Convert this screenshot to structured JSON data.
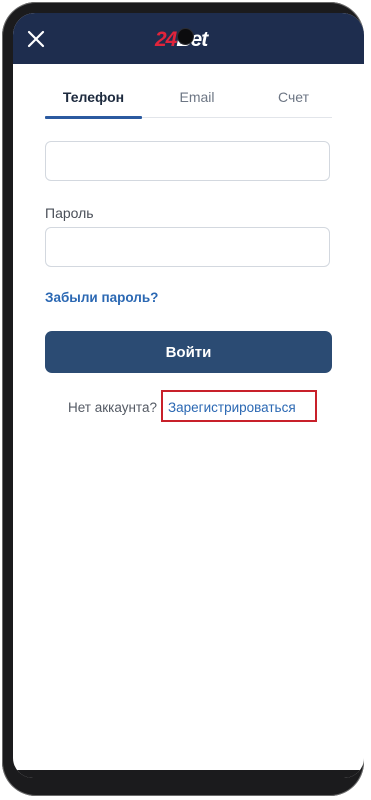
{
  "header": {
    "logo_number": "24",
    "logo_text": "Bet",
    "close_icon": "close-icon"
  },
  "tabs": [
    {
      "label": "Телефон",
      "active": true
    },
    {
      "label": "Email",
      "active": false
    },
    {
      "label": "Счет",
      "active": false
    }
  ],
  "form": {
    "phone_value": "",
    "password_label": "Пароль",
    "password_value": "",
    "forgot_link": "Забыли пароль?",
    "login_button": "Войти"
  },
  "footer": {
    "no_account_text": "Нет аккаунта?",
    "register_link": "Зарегистрироваться"
  },
  "colors": {
    "header_bg": "#1e2d4e",
    "accent_link": "#2b68b3",
    "button_bg": "#2b4b73",
    "logo_red": "#e0243b",
    "highlight_box": "#c8202a"
  }
}
